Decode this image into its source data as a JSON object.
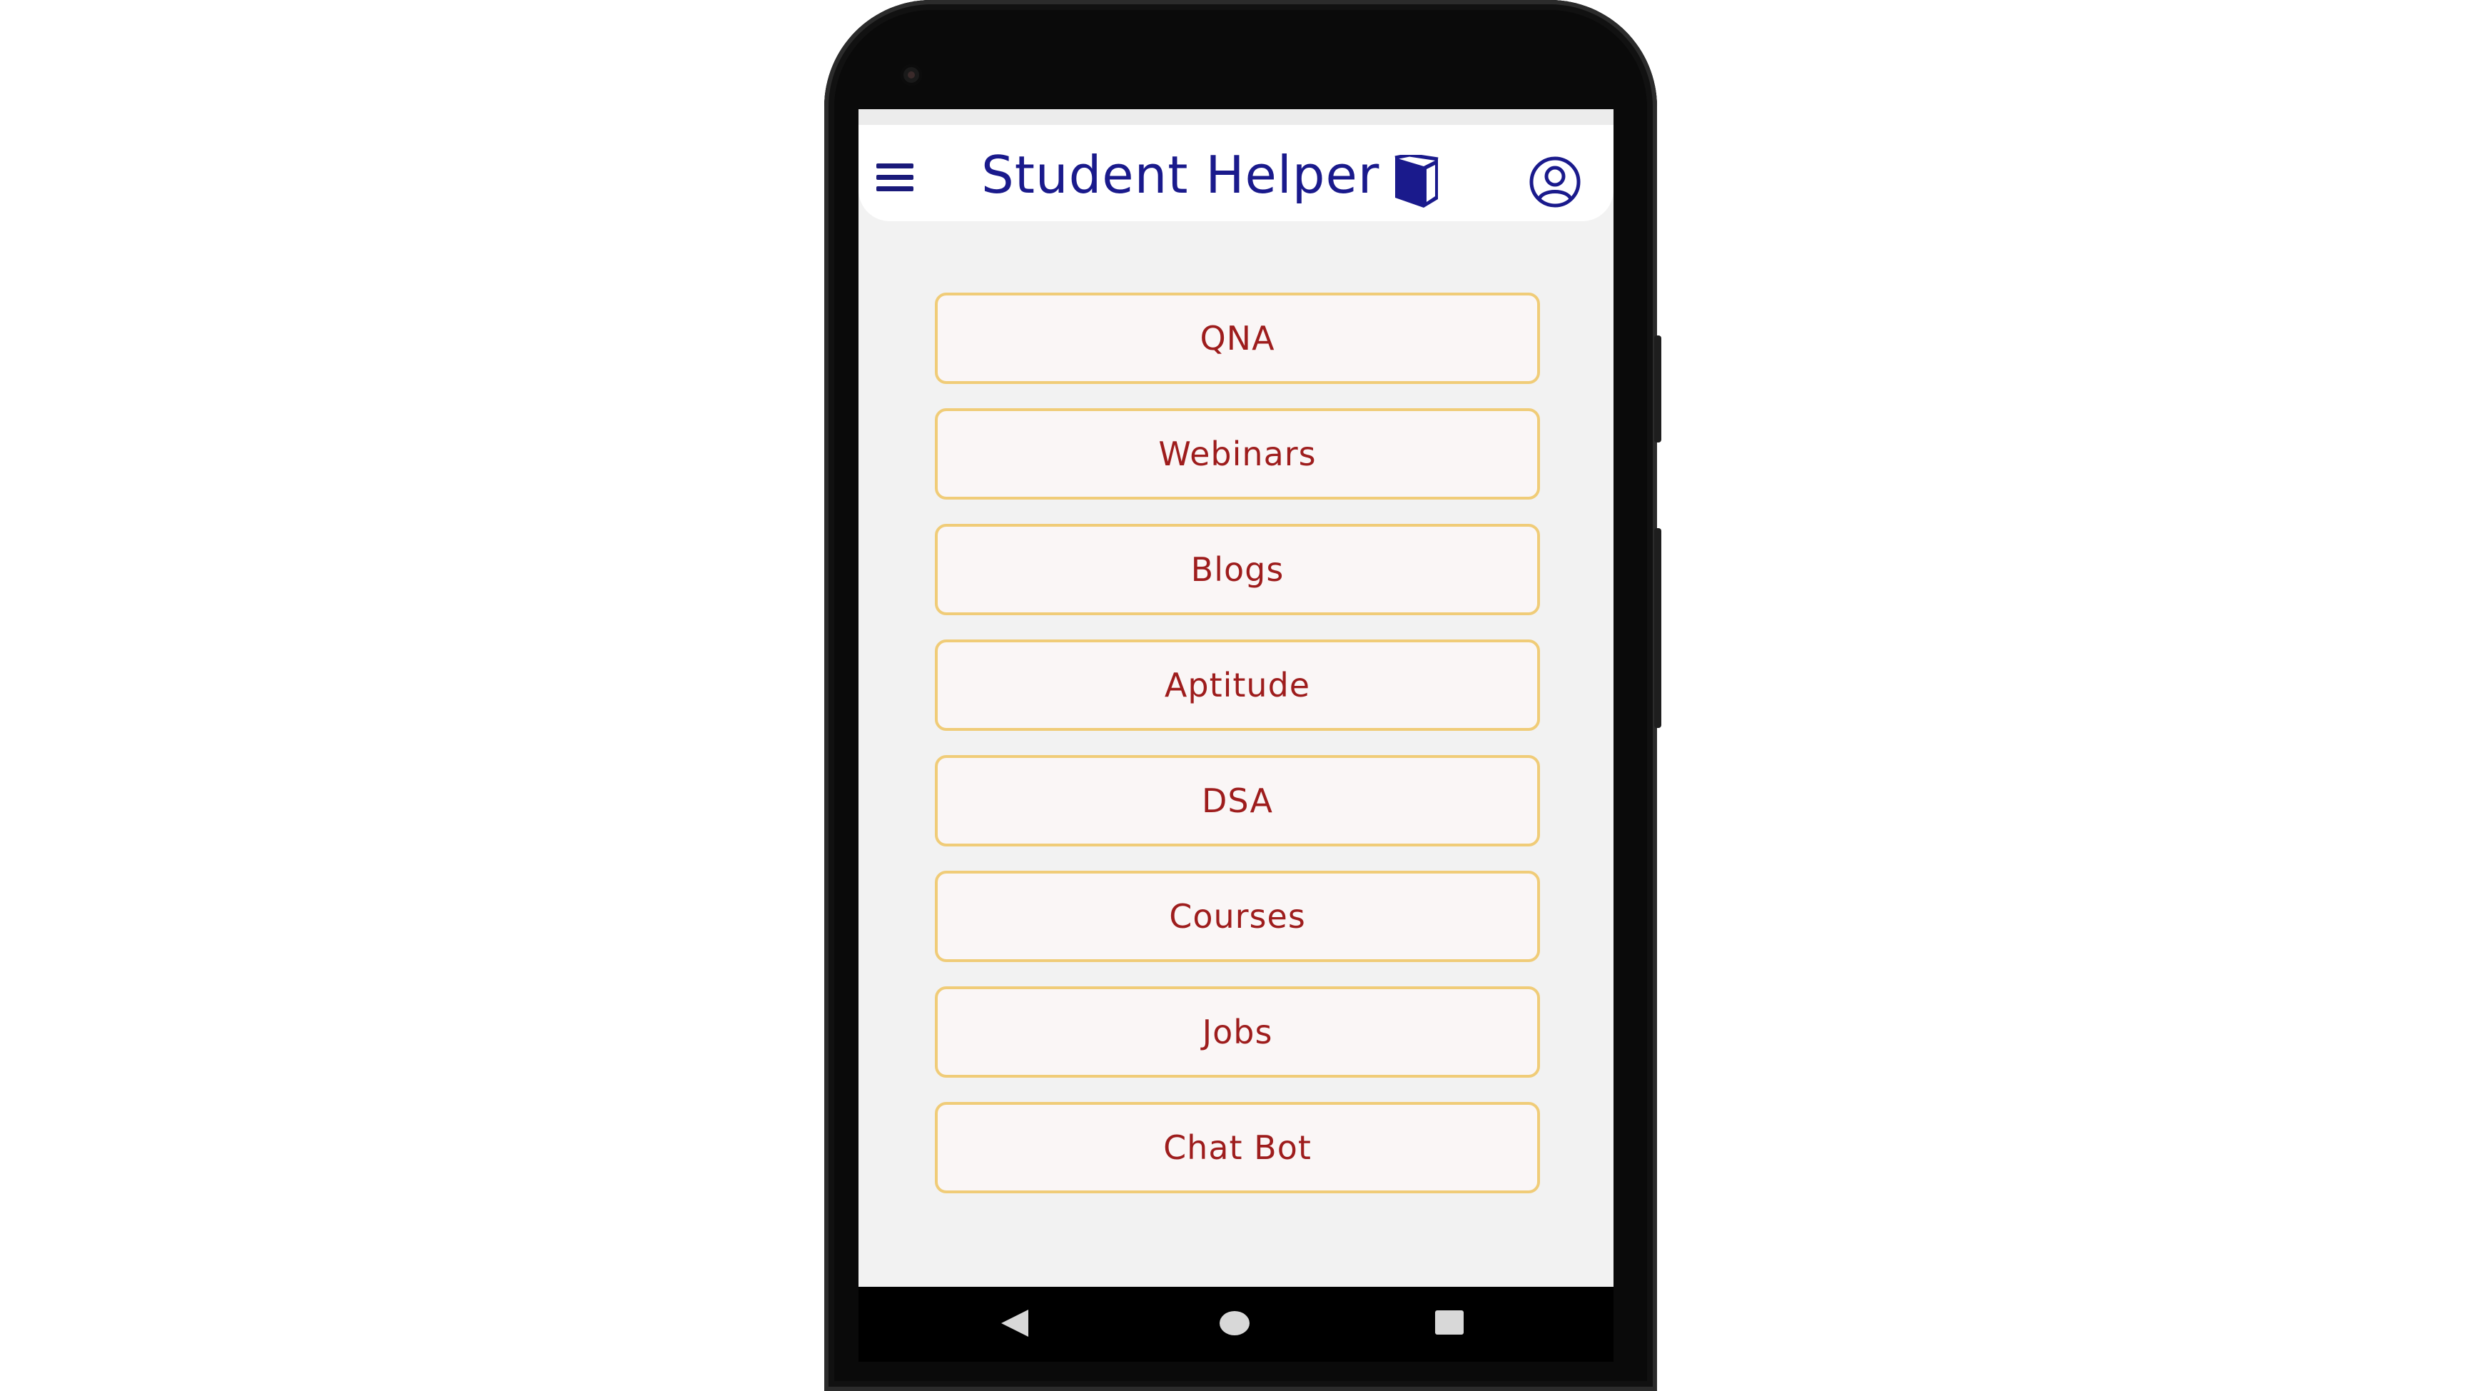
{
  "app": {
    "title": "Student Helper"
  },
  "icons": {
    "menu": "hamburger-menu-icon",
    "logo": "book-icon",
    "profile": "user-circle-icon",
    "nav_back": "triangle-back-icon",
    "nav_home": "circle-home-icon",
    "nav_recent": "square-recents-icon"
  },
  "menu": {
    "items": [
      {
        "label": "QNA"
      },
      {
        "label": "Webinars"
      },
      {
        "label": "Blogs"
      },
      {
        "label": "Aptitude"
      },
      {
        "label": "DSA"
      },
      {
        "label": "Courses"
      },
      {
        "label": "Jobs"
      },
      {
        "label": "Chat Bot"
      }
    ]
  },
  "colors": {
    "title": "#1a1a8c",
    "button_text": "#9e1d1d",
    "button_border": "#f0cc78",
    "button_bg": "#faf6f6",
    "screen_bg": "#f2f2f2"
  }
}
